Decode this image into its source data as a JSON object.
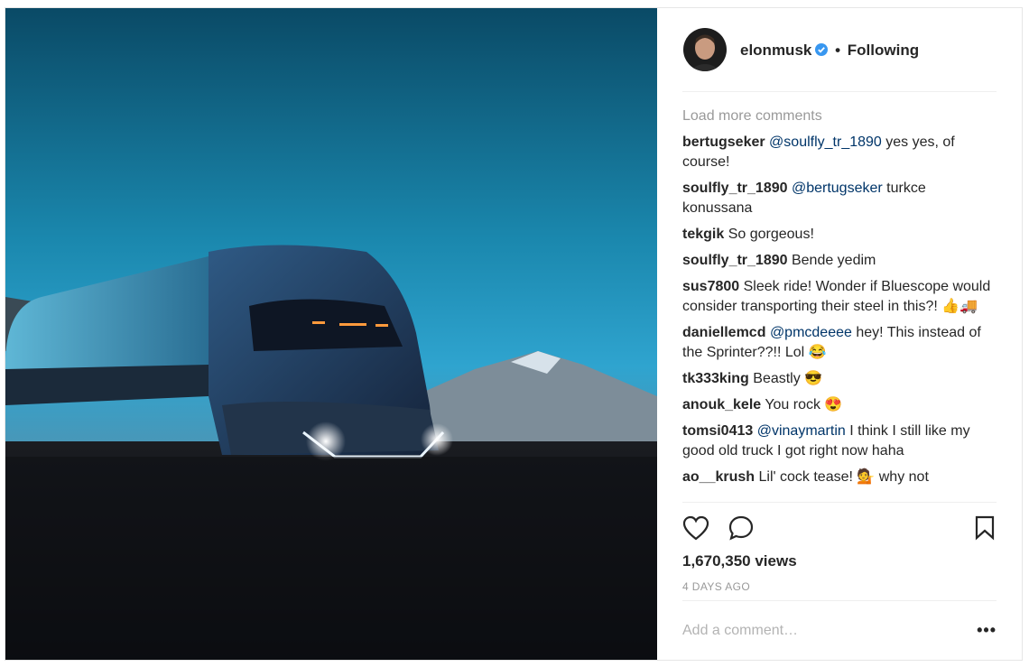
{
  "header": {
    "username": "elonmusk",
    "verified_icon": "verified-badge-icon",
    "separator": "•",
    "follow_status": "Following"
  },
  "comments": {
    "load_more": "Load more comments",
    "items": [
      {
        "user": "bertugseker",
        "mention": "@soulfly_tr_1890",
        "text": " yes yes, of course!"
      },
      {
        "user": "soulfly_tr_1890",
        "mention": "@bertugseker",
        "text": " turkce konussana"
      },
      {
        "user": "tekgik",
        "mention": "",
        "text": "So gorgeous!"
      },
      {
        "user": "soulfly_tr_1890",
        "mention": "",
        "text": "Bende yedim"
      },
      {
        "user": "sus7800",
        "mention": "",
        "text": "Sleek ride! Wonder if Bluescope would consider transporting their steel in this?! 👍🚚"
      },
      {
        "user": "daniellemcd",
        "mention": "@pmcdeeee",
        "text": " hey! This instead of the Sprinter??!! Lol 😂"
      },
      {
        "user": "tk333king",
        "mention": "",
        "text": "Beastly 😎"
      },
      {
        "user": "anouk_kele",
        "mention": "",
        "text": "You rock 😍"
      },
      {
        "user": "tomsi0413",
        "mention": "@vinaymartin",
        "text": " I think I still like my good old truck I got right now haha"
      },
      {
        "user": "ao__krush",
        "mention": "",
        "text": "Lil' cock tease! 💁 why not"
      }
    ]
  },
  "actions": {
    "like_icon": "heart-icon",
    "comment_icon": "comment-bubble-icon",
    "save_icon": "bookmark-icon",
    "views": "1,670,350 views",
    "time_ago": "4 DAYS AGO"
  },
  "add_comment": {
    "placeholder": "Add a comment…",
    "more_label": "•••"
  },
  "colors": {
    "mention": "#003569",
    "verified": "#3897f0",
    "muted": "#999999"
  }
}
